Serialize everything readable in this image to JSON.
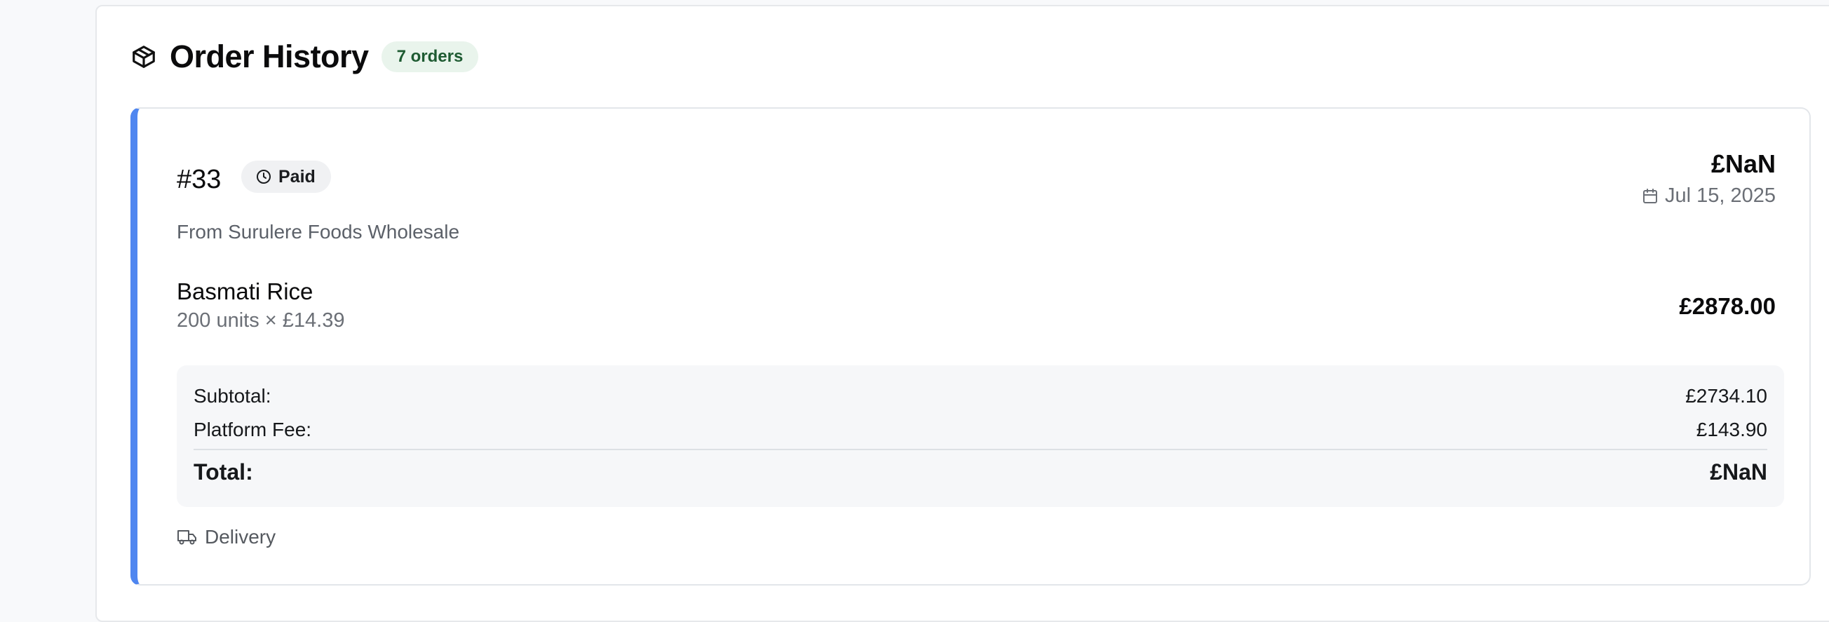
{
  "header": {
    "title": "Order History",
    "order_count": "7 orders",
    "icon": "package-icon"
  },
  "orders": [
    {
      "number": "#33",
      "status": "Paid",
      "status_icon": "clock-icon",
      "total": "£NaN",
      "date": "Jul 15, 2025",
      "date_icon": "calendar-icon",
      "supplier": "From Surulere Foods Wholesale",
      "items": [
        {
          "name": "Basmati Rice",
          "quantity": "200 units × £14.39",
          "price": "£2878.00"
        }
      ],
      "summary": {
        "subtotal_label": "Subtotal:",
        "subtotal_value": "£2734.10",
        "fee_label": "Platform Fee:",
        "fee_value": "£143.90",
        "total_label": "Total:",
        "total_value": "£NaN"
      },
      "fulfillment": "Delivery",
      "fulfillment_icon": "truck-icon",
      "accent_color": "#4f86f0"
    }
  ],
  "colors": {
    "accent": "#4f86f0",
    "badge_bg": "#e9f4ec",
    "badge_text": "#1e5b32"
  }
}
